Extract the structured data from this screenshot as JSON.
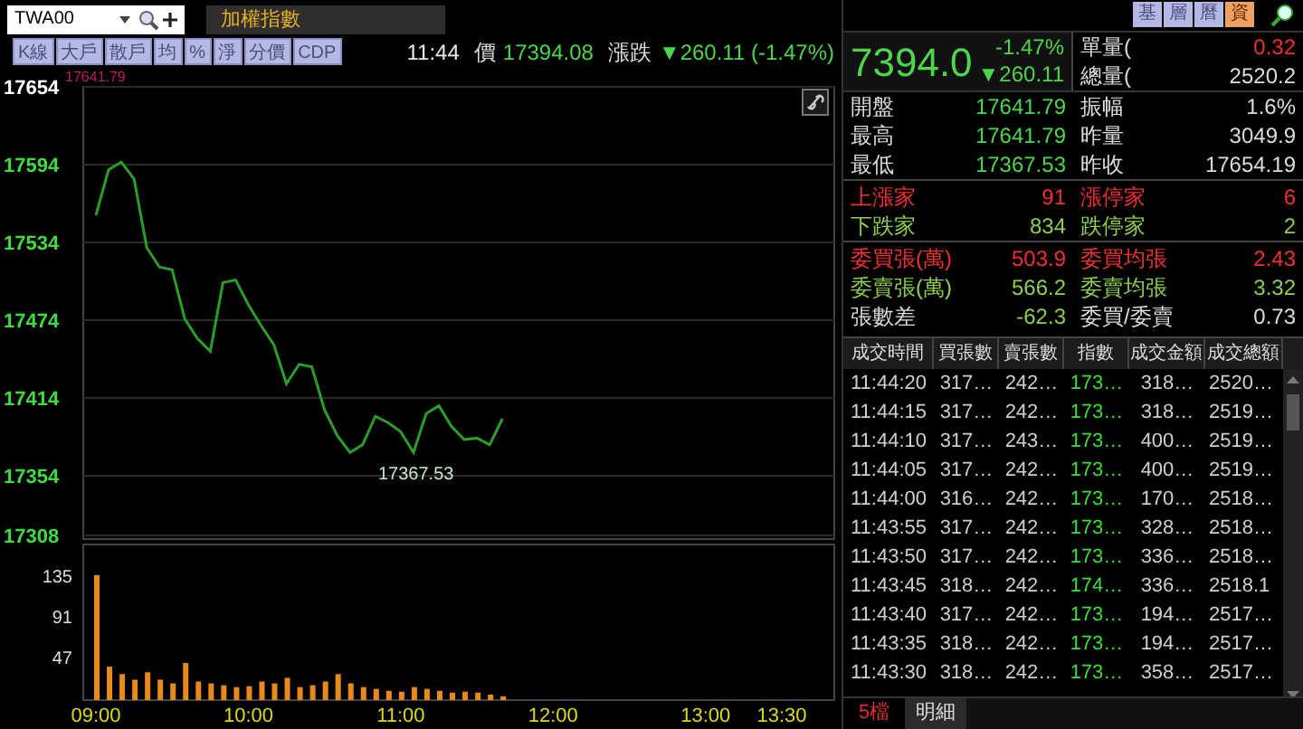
{
  "symbol_field": {
    "value": "TWA00"
  },
  "title": "加權指數",
  "toolbar": [
    {
      "label": "K線"
    },
    {
      "label": "大戶"
    },
    {
      "label": "散戶"
    },
    {
      "label": "均"
    },
    {
      "label": "%"
    },
    {
      "label": "淨"
    },
    {
      "label": "分價"
    },
    {
      "label": "CDP"
    }
  ],
  "ticker": {
    "time": "11:44",
    "price_label": "價",
    "price": "17394.08",
    "change_label": "漲跌",
    "change": "▼260.11 (-1.47%)"
  },
  "price_chart": {
    "chart_data": {
      "type": "line",
      "categories": [
        null,
        null,
        null,
        null,
        null,
        null,
        null,
        null,
        null,
        null,
        null,
        null,
        null,
        null,
        null,
        null,
        null,
        null,
        null,
        null,
        null,
        null,
        null,
        null,
        null,
        null,
        null,
        null,
        null,
        null,
        null,
        null,
        null,
        null,
        null,
        null,
        null,
        null,
        null,
        null,
        null,
        null,
        null,
        null,
        null,
        null,
        null,
        null,
        null,
        null,
        null,
        null,
        null,
        null,
        null
      ],
      "series": [
        {
          "color": "#2a9d2a",
          "values": [
            17555,
            17590,
            17596,
            17583,
            17530,
            17515,
            17513,
            17475,
            17460,
            17450,
            17503,
            17505,
            17486,
            17470,
            17455,
            17425,
            17440,
            17438,
            17405,
            17385,
            17372,
            17378,
            17400,
            17395,
            17388,
            17372,
            17402,
            17408,
            17392,
            17382,
            17383,
            17378,
            17398,
            null,
            null,
            null,
            null,
            null,
            null,
            null,
            null,
            null,
            null,
            null,
            null,
            null,
            null,
            null,
            null,
            null,
            null,
            null,
            null,
            null,
            null
          ]
        }
      ],
      "ylim": [
        17308,
        17654
      ],
      "yticks": [
        17654,
        17594,
        17534,
        17474,
        17414,
        17354,
        17308
      ],
      "grid": true,
      "annotations": [
        {
          "text": "17641.79"
        },
        {
          "text": "17367.53"
        }
      ]
    }
  },
  "volume_chart": {
    "chart_data": {
      "type": "bar",
      "categories": [
        "09:00",
        null,
        null,
        null,
        null,
        null,
        null,
        null,
        null,
        null,
        null,
        null,
        "10:00",
        null,
        null,
        null,
        null,
        null,
        null,
        null,
        null,
        null,
        null,
        null,
        "11:00",
        null,
        null,
        null,
        null,
        null,
        null,
        null,
        null,
        null,
        null,
        null,
        "12:00",
        null,
        null,
        null,
        null,
        null,
        null,
        null,
        null,
        null,
        null,
        null,
        "13:00",
        null,
        null,
        null,
        null,
        null,
        "13:30"
      ],
      "series": [
        {
          "color": "#e8891c",
          "values": [
            135,
            36,
            28,
            22,
            30,
            22,
            18,
            40,
            20,
            18,
            16,
            14,
            15,
            20,
            18,
            24,
            14,
            16,
            20,
            28,
            18,
            14,
            12,
            10,
            9,
            14,
            12,
            10,
            8,
            9,
            8,
            6,
            4,
            null,
            null,
            null,
            null,
            null,
            null,
            null,
            null,
            null,
            null,
            null,
            null,
            null,
            null,
            null,
            null,
            null,
            null,
            null,
            null,
            null,
            null
          ]
        }
      ],
      "ylim": [
        0,
        168
      ],
      "yticks": [
        47,
        91,
        135
      ]
    }
  },
  "panel_tabs": [
    {
      "label": "基",
      "selected": false
    },
    {
      "label": "層",
      "selected": false
    },
    {
      "label": "曆",
      "selected": false
    },
    {
      "label": "資",
      "selected": true
    }
  ],
  "quote": {
    "price": "7394.0",
    "change_pct": "-1.47%",
    "change": "▼260.11",
    "unit_volume_label": "單量(",
    "unit_volume": "0.32",
    "total_volume_label": "總量(",
    "total_volume": "2520.2"
  },
  "stats": [
    [
      {
        "text": "開盤",
        "color": "#dcdcdc"
      },
      {
        "text": "17641.79",
        "color": "#4cd64c"
      },
      {
        "text": "振幅",
        "color": "#dcdcdc"
      },
      {
        "text": "1.6%",
        "color": "#dcdcdc"
      }
    ],
    [
      {
        "text": "最高",
        "color": "#dcdcdc"
      },
      {
        "text": "17641.79",
        "color": "#4cd64c"
      },
      {
        "text": "昨量",
        "color": "#dcdcdc"
      },
      {
        "text": "3049.9",
        "color": "#dcdcdc"
      }
    ],
    [
      {
        "text": "最低",
        "color": "#dcdcdc"
      },
      {
        "text": "17367.53",
        "color": "#4cd64c"
      },
      {
        "text": "昨收",
        "color": "#dcdcdc"
      },
      {
        "text": "17654.19",
        "color": "#dcdcdc"
      }
    ],
    [
      {
        "text": "上漲家",
        "color": "#f03030"
      },
      {
        "text": "91",
        "color": "#f03030"
      },
      {
        "text": "漲停家",
        "color": "#f03030"
      },
      {
        "text": "6",
        "color": "#f03030"
      }
    ],
    [
      {
        "text": "下跌家",
        "color": "#8ccf4c"
      },
      {
        "text": "834",
        "color": "#8ccf4c"
      },
      {
        "text": "跌停家",
        "color": "#8ccf4c"
      },
      {
        "text": "2",
        "color": "#8ccf4c"
      }
    ],
    [
      {
        "text": "委買張(萬)",
        "color": "#f03030"
      },
      {
        "text": "503.9",
        "color": "#f03030"
      },
      {
        "text": "委買均張",
        "color": "#f03030"
      },
      {
        "text": "2.43",
        "color": "#f03030"
      }
    ],
    [
      {
        "text": "委賣張(萬)",
        "color": "#8ccf4c"
      },
      {
        "text": "566.2",
        "color": "#8ccf4c"
      },
      {
        "text": "委賣均張",
        "color": "#8ccf4c"
      },
      {
        "text": "3.32",
        "color": "#8ccf4c"
      }
    ],
    [
      {
        "text": "張數差",
        "color": "#dcdcdc"
      },
      {
        "text": "-62.3",
        "color": "#8ccf4c"
      },
      {
        "text": "委買/委賣",
        "color": "#dcdcdc"
      },
      {
        "text": "0.73",
        "color": "#dcdcdc"
      }
    ]
  ],
  "trades": {
    "columns": [
      "成交時間",
      "買張數",
      "賣張數",
      "指數",
      "成交金額",
      "成交總額"
    ],
    "rows": [
      [
        "11:44:20",
        "317…",
        "242…",
        "173…",
        "318…",
        "2520…"
      ],
      [
        "11:44:15",
        "317…",
        "242…",
        "173…",
        "318…",
        "2519…"
      ],
      [
        "11:44:10",
        "317…",
        "243…",
        "173…",
        "400…",
        "2519…"
      ],
      [
        "11:44:05",
        "317…",
        "242…",
        "173…",
        "400…",
        "2519…"
      ],
      [
        "11:44:00",
        "316…",
        "242…",
        "173…",
        "170…",
        "2518…"
      ],
      [
        "11:43:55",
        "317…",
        "242…",
        "173…",
        "328…",
        "2518…"
      ],
      [
        "11:43:50",
        "317…",
        "242…",
        "173…",
        "336…",
        "2518…"
      ],
      [
        "11:43:45",
        "318…",
        "242…",
        "174…",
        "336…",
        "2518.1"
      ],
      [
        "11:43:40",
        "317…",
        "242…",
        "173…",
        "194…",
        "2517…"
      ],
      [
        "11:43:35",
        "318…",
        "242…",
        "173…",
        "194…",
        "2517…"
      ],
      [
        "11:43:30",
        "318…",
        "242…",
        "173…",
        "358…",
        "2517…"
      ]
    ]
  },
  "bottom_tabs": [
    {
      "label": "5檔",
      "selected": false
    },
    {
      "label": "明細",
      "selected": true
    }
  ]
}
